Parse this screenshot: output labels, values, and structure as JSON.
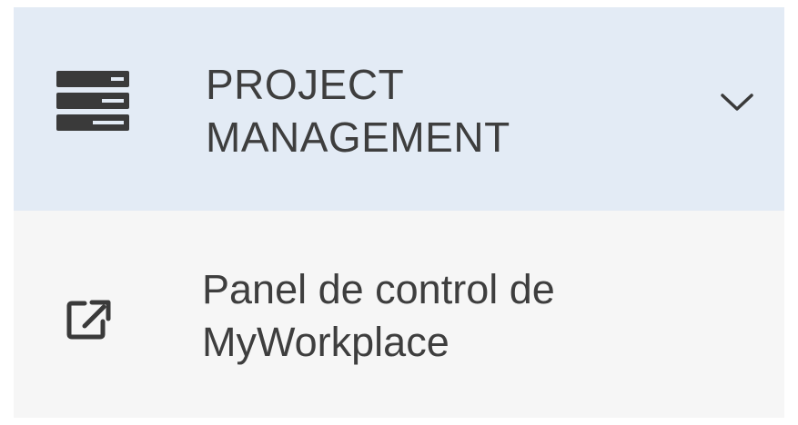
{
  "menu": {
    "section": {
      "label": "PROJECT MANAGEMENT",
      "icon": "server-stack-icon",
      "expand_icon": "chevron-down-icon",
      "expanded": true
    },
    "items": [
      {
        "label": "Panel de control de MyWorkplace",
        "icon": "external-link-icon"
      }
    ]
  },
  "colors": {
    "header_bg": "#e3ebf5",
    "item_bg": "#f6f6f6",
    "text": "#3e3e3e",
    "icon": "#3a3a3a"
  }
}
